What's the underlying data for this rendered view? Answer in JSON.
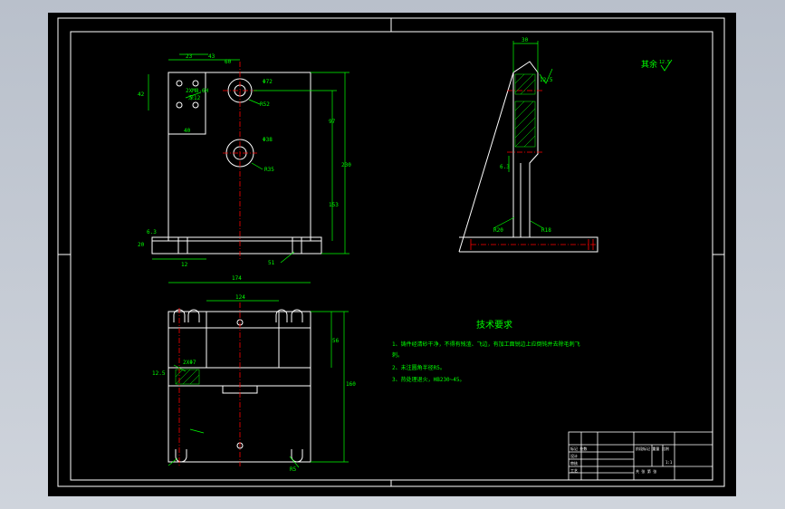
{
  "colors": {
    "canvas": "#000000",
    "frame": "#ffffff",
    "geometry": "#ffffff",
    "dimension": "#00ff00",
    "centerline": "#ff0000",
    "hatch": "#00ff00",
    "notes": "#ffff00",
    "cyan": "#00ffff"
  },
  "roughness_note": {
    "label": "其余",
    "value": "12.5"
  },
  "tech_requirements": {
    "title": "技术要求",
    "lines": [
      "1、铸件经清砂干净，不得有残渣、飞边，有加工面锐边上应倒钝并去除毛刺飞",
      "刺。",
      "2、未注圆角半径R5。",
      "3、热处理退火，HB230~45。"
    ]
  },
  "front_view_dims": {
    "top_a": "23",
    "top_b": "43",
    "top_c": "60",
    "left_a": "42",
    "hole_note1": "2XM8-6H",
    "hole_note2": "深12",
    "bottom_a": "40",
    "bore1": "Φ72",
    "bore1_r": "R52",
    "bore2": "Φ38",
    "bore2_r": "R35",
    "right_a": "97",
    "right_b": "153",
    "right_c": "230",
    "base_h": "20",
    "base_t": "6.3",
    "base_w1": "12",
    "base_w2": "51"
  },
  "side_view_dims": {
    "top_w": "30",
    "rib": "12.5",
    "gap": "6.3",
    "r1": "R20",
    "r2": "R18"
  },
  "top_view_dims": {
    "overall_w": "174",
    "inner_w": "124",
    "depth": "160",
    "side_h": "56",
    "rough": "12.5",
    "slot": "2XΦ7",
    "bottom_r": "R5"
  },
  "title_block": {
    "row1": "标记 处数",
    "row2": "设计",
    "row3": "审核",
    "row4": "工艺",
    "right1": "阶段标记 重量 比例",
    "right2": "1:1",
    "right3": "共 张 第 张"
  }
}
